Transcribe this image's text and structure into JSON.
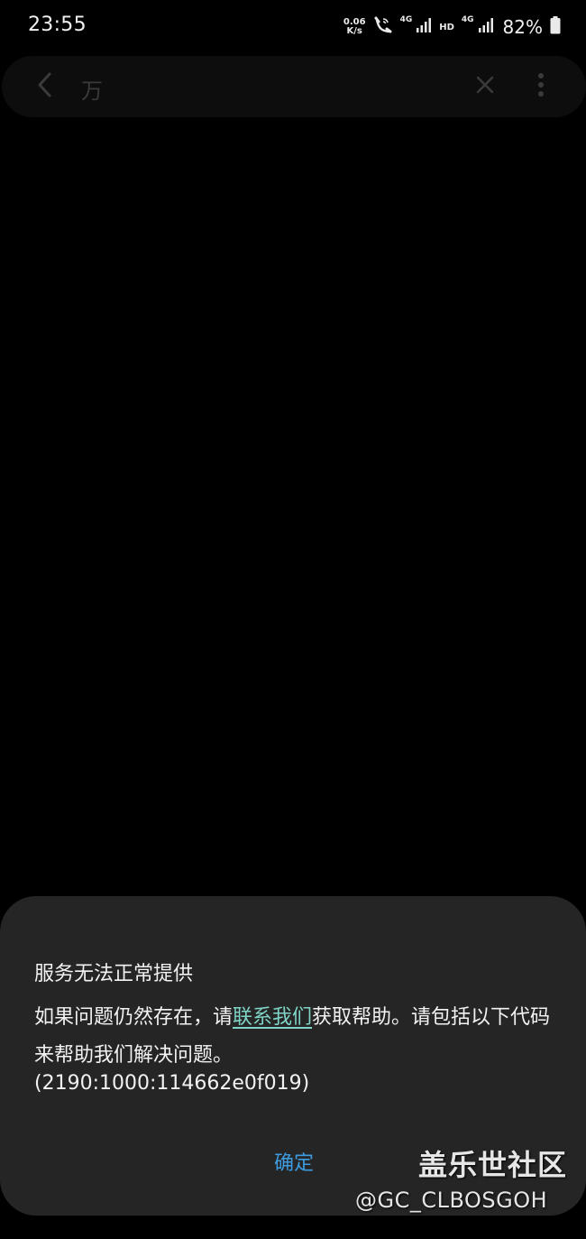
{
  "status_bar": {
    "time": "23:55",
    "net_speed_value": "0.06",
    "net_speed_unit": "K/s",
    "sim1_network": "4G",
    "hd_label": "HD",
    "sim2_network": "4G",
    "battery_percent": "82%"
  },
  "search_bar": {
    "query": "万",
    "icons": {
      "back": "chevron-left-icon",
      "clear": "close-icon",
      "more": "more-vertical-icon"
    }
  },
  "dialog": {
    "title": "服务无法正常提供",
    "message_before_link": "如果问题仍然存在，请",
    "link_text": "联系我们",
    "message_after_link": "获取帮助。请包括以下代码来帮助我们解决问题。",
    "error_code": "(2190:1000:114662e0f019)",
    "confirm_label": "确定",
    "colors": {
      "background": "#252525",
      "link": "#7fd4c6",
      "button": "#3d9be0"
    }
  },
  "watermark": {
    "title": "盖乐世社区",
    "handle": "@GC_CLBOSGOH"
  }
}
